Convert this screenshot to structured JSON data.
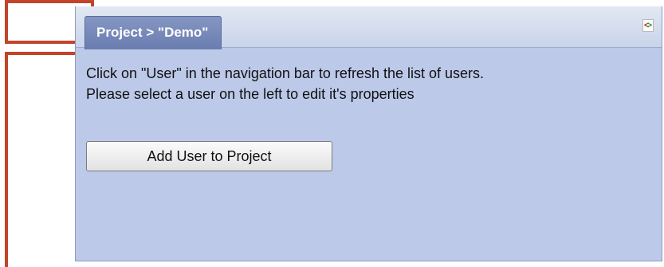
{
  "panel": {
    "tab_title": "Project > \"Demo\"",
    "refresh_icon": "refresh-icon"
  },
  "content": {
    "line1": "Click on \"User\" in the navigation bar to refresh the list of users.",
    "line2": "Please select a user on the left to edit it's properties"
  },
  "actions": {
    "add_user_label": "Add User to Project"
  },
  "colors": {
    "panel_bg": "#bcc9e9",
    "tab_bg": "#6a7db0",
    "annotation": "#c2442a"
  }
}
